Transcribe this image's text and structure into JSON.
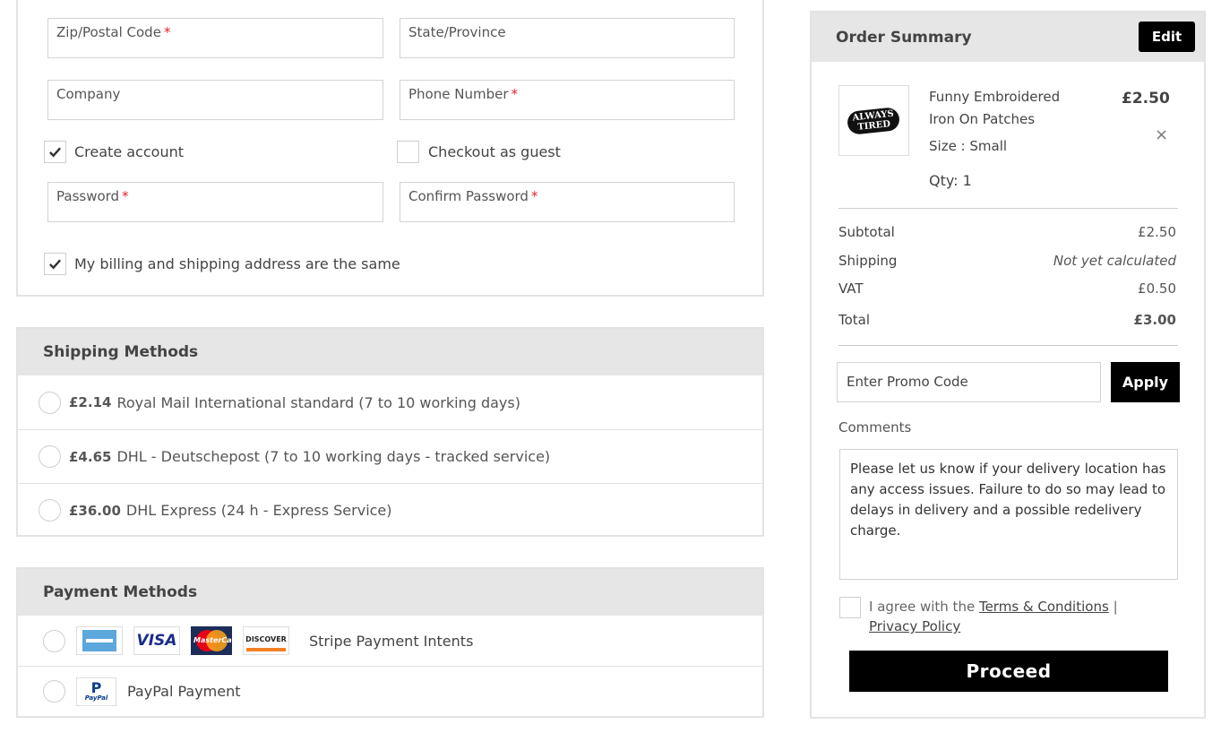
{
  "address": {
    "zip_label": "Zip/Postal Code",
    "state_label": "State/Province",
    "company_label": "Company",
    "phone_label": "Phone Number",
    "create_account_label": "Create account",
    "create_account_checked": true,
    "guest_label": "Checkout as guest",
    "guest_checked": false,
    "password_label": "Password",
    "confirm_password_label": "Confirm Password",
    "same_address_label": "My billing and shipping address are the same",
    "same_address_checked": true,
    "required_mark": "*"
  },
  "shipping": {
    "title": "Shipping Methods",
    "options": [
      {
        "price": "£2.14",
        "name": "Royal Mail International standard (7 to 10 working days)"
      },
      {
        "price": "£4.65",
        "name": "DHL - Deutschepost (7 to 10 working days - tracked service)"
      },
      {
        "price": "£36.00",
        "name": "DHL Express (24 h - Express Service)"
      }
    ]
  },
  "payment": {
    "title": "Payment Methods",
    "options": [
      {
        "name": "Stripe Payment Intents",
        "cards": [
          "amex-icon",
          "visa-icon",
          "mastercard-icon",
          "discover-icon"
        ]
      },
      {
        "name": "PayPal Payment",
        "cards": [
          "paypal-icon"
        ]
      }
    ],
    "card_text": {
      "visa": "VISA",
      "mastercard": "MasterCard",
      "discover": "DISCOVER",
      "paypal": "PayPal"
    }
  },
  "summary": {
    "title": "Order Summary",
    "edit_label": "Edit",
    "item": {
      "name_line1": "Funny Embroidered",
      "name_line2": "Iron On Patches",
      "price": "£2.50",
      "size": "Size : Small",
      "qty": "Qty: 1",
      "remove": "×",
      "thumb_text_1": "ALWAYS",
      "thumb_text_2": "TIRED"
    },
    "subtotal_label": "Subtotal",
    "subtotal_value": "£2.50",
    "shipping_label": "Shipping",
    "shipping_value": "Not yet calculated",
    "vat_label": "VAT",
    "vat_value": "£0.50",
    "total_label": "Total",
    "total_value": "£3.00",
    "promo_placeholder": "Enter Promo Code",
    "apply_label": "Apply",
    "comments_label": "Comments",
    "comments_text": "Please let us know if your delivery location has any access issues. Failure to do so may lead to delays in delivery and a possible redelivery charge.",
    "agree_prefix": "I agree with the",
    "terms_link": "Terms & Conditions",
    "separator": "|",
    "privacy_link": "Privacy Policy",
    "proceed_label": "Proceed"
  },
  "colors": {
    "accent": "#000000",
    "required": "#e0262c",
    "panel_header": "#e6e6e6"
  }
}
